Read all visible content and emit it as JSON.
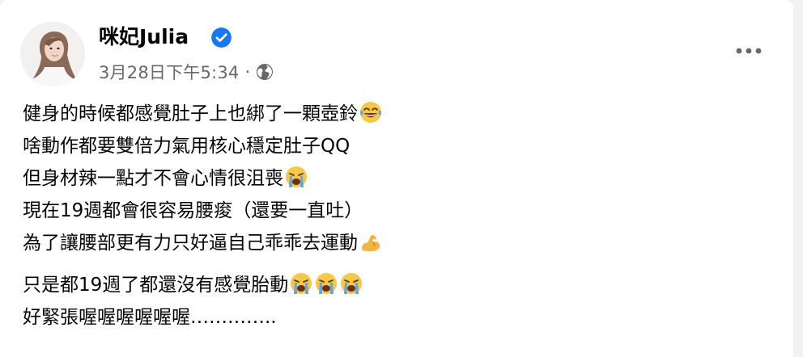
{
  "post": {
    "author": {
      "name": "咪妃Julia",
      "verified": true
    },
    "timestamp": "3月28日下午5:34",
    "separator": "·",
    "privacy_icon": "globe-icon",
    "more_icon": "more-options-icon",
    "paragraph1": [
      {
        "text": "健身的時候都感覺肚子上也綁了一顆壺鈴",
        "emoji": "joy-emoji"
      },
      {
        "text": "啥動作都要雙倍力氣用核心穩定肚子QQ",
        "emoji": null
      },
      {
        "text": "但身材辣一點才不會心情很沮喪",
        "emoji": "crying-emoji"
      },
      {
        "text": "現在19週都會很容易腰痠（還要一直吐）",
        "emoji": null
      },
      {
        "text": "為了讓腰部更有力只好逼自己乖乖去運動",
        "emoji": "flexed-biceps-emoji"
      }
    ],
    "paragraph2": [
      {
        "text": "只是都19週了都還沒有感覺胎動",
        "emoji": "crying-emoji x3"
      },
      {
        "text": "好緊張喔喔喔喔喔喔…………..",
        "emoji": null
      }
    ]
  },
  "colors": {
    "background": "#f0f2f5",
    "card": "#ffffff",
    "primary_text": "#050505",
    "secondary_text": "#65676b",
    "verified_blue": "#1877f2"
  }
}
